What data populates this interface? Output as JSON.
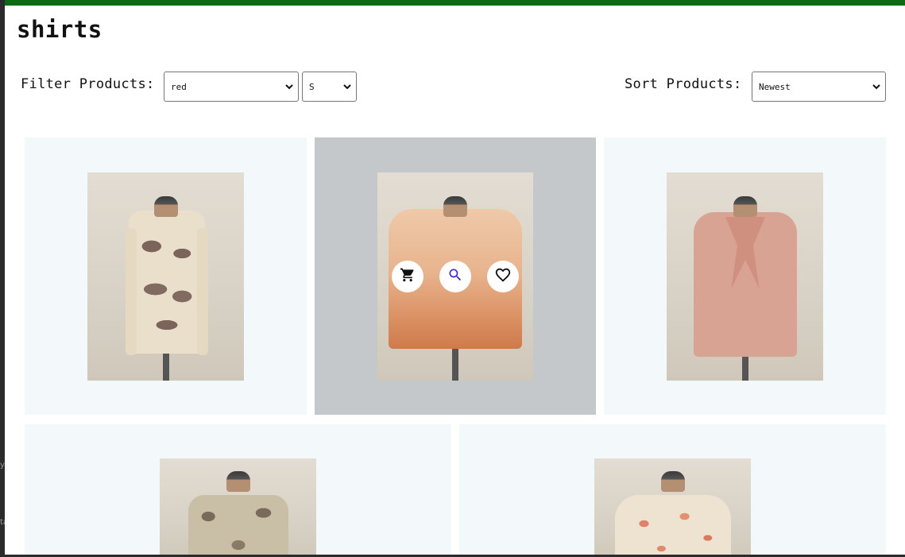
{
  "page": {
    "title": "shirts"
  },
  "filters": {
    "label": "Filter Products:",
    "color_value": "red",
    "size_value": "S"
  },
  "sort": {
    "label": "Sort Products:",
    "value": "Newest"
  },
  "colors": {
    "topbar": "#0b6b12",
    "card_bg": "#f3f9fb",
    "card_hover_bg": "#c4c8cb",
    "search_icon": "#3f24c9"
  },
  "products": [
    {
      "name": "cream cardigan with brown print",
      "hovered": false
    },
    {
      "name": "orange tie-dye tee",
      "hovered": true
    },
    {
      "name": "pink tie-neck blouse",
      "hovered": false
    },
    {
      "name": "sleeveless leaf-print top",
      "hovered": false
    },
    {
      "name": "floral print top",
      "hovered": false
    }
  ],
  "actions": {
    "cart_icon": "cart-icon",
    "search_icon": "search-icon",
    "wishlist_icon": "heart-icon"
  },
  "gutter": {
    "mark_1": "y",
    "mark_2": "ta"
  }
}
